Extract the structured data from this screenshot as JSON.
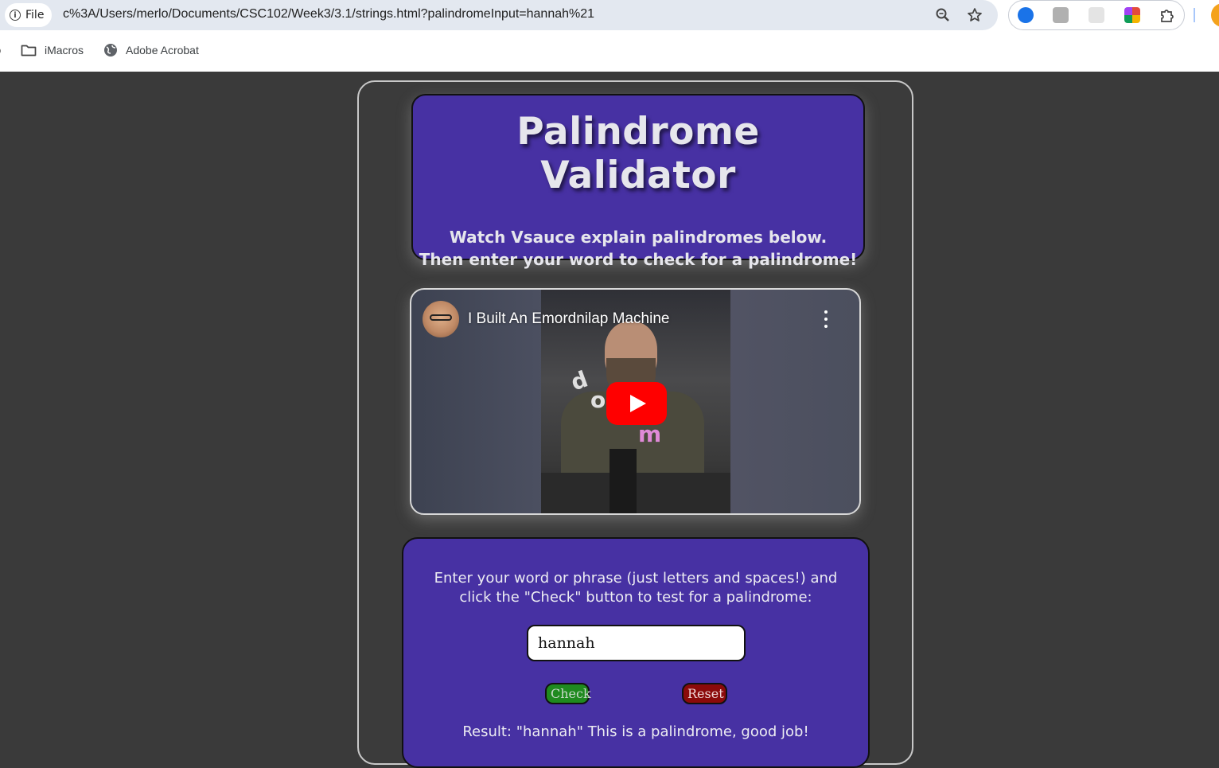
{
  "browser": {
    "site_chip_label": "File",
    "url": "c%3A/Users/merlo/Documents/CSC102/Week3/3.1/strings.html?palindromeInput=hannah%21",
    "bookmarks": [
      {
        "label": "iMacros",
        "icon": "folder-icon"
      },
      {
        "label": "Adobe Acrobat",
        "icon": "globe-icon"
      }
    ],
    "extension_colors": [
      "#1a73e8",
      "#b0b0b0",
      "#c8c8c8",
      "#e34b3c"
    ]
  },
  "header": {
    "title": "Palindrome Validator",
    "subtitle_line1": "Watch Vsauce explain palindromes below.",
    "subtitle_line2": "Then enter your word to check for a palindrome!"
  },
  "video": {
    "title": "I Built An Emordnilap Machine",
    "play_icon": "play-icon",
    "menu_icon": "more-vert-icon"
  },
  "form": {
    "instructions": "Enter your word or phrase (just letters and spaces!) and click the \"Check\" button to test for a palindrome:",
    "input_value": "hannah",
    "check_label": "Check",
    "reset_label": "Reset",
    "result_text": "Result: \"hannah\" This is a palindrome, good job!"
  },
  "colors": {
    "card_purple": "#4731a3",
    "page_bg": "#3a3a3a",
    "check_green": "#1f8a1f",
    "reset_red": "#8b0a0a"
  }
}
